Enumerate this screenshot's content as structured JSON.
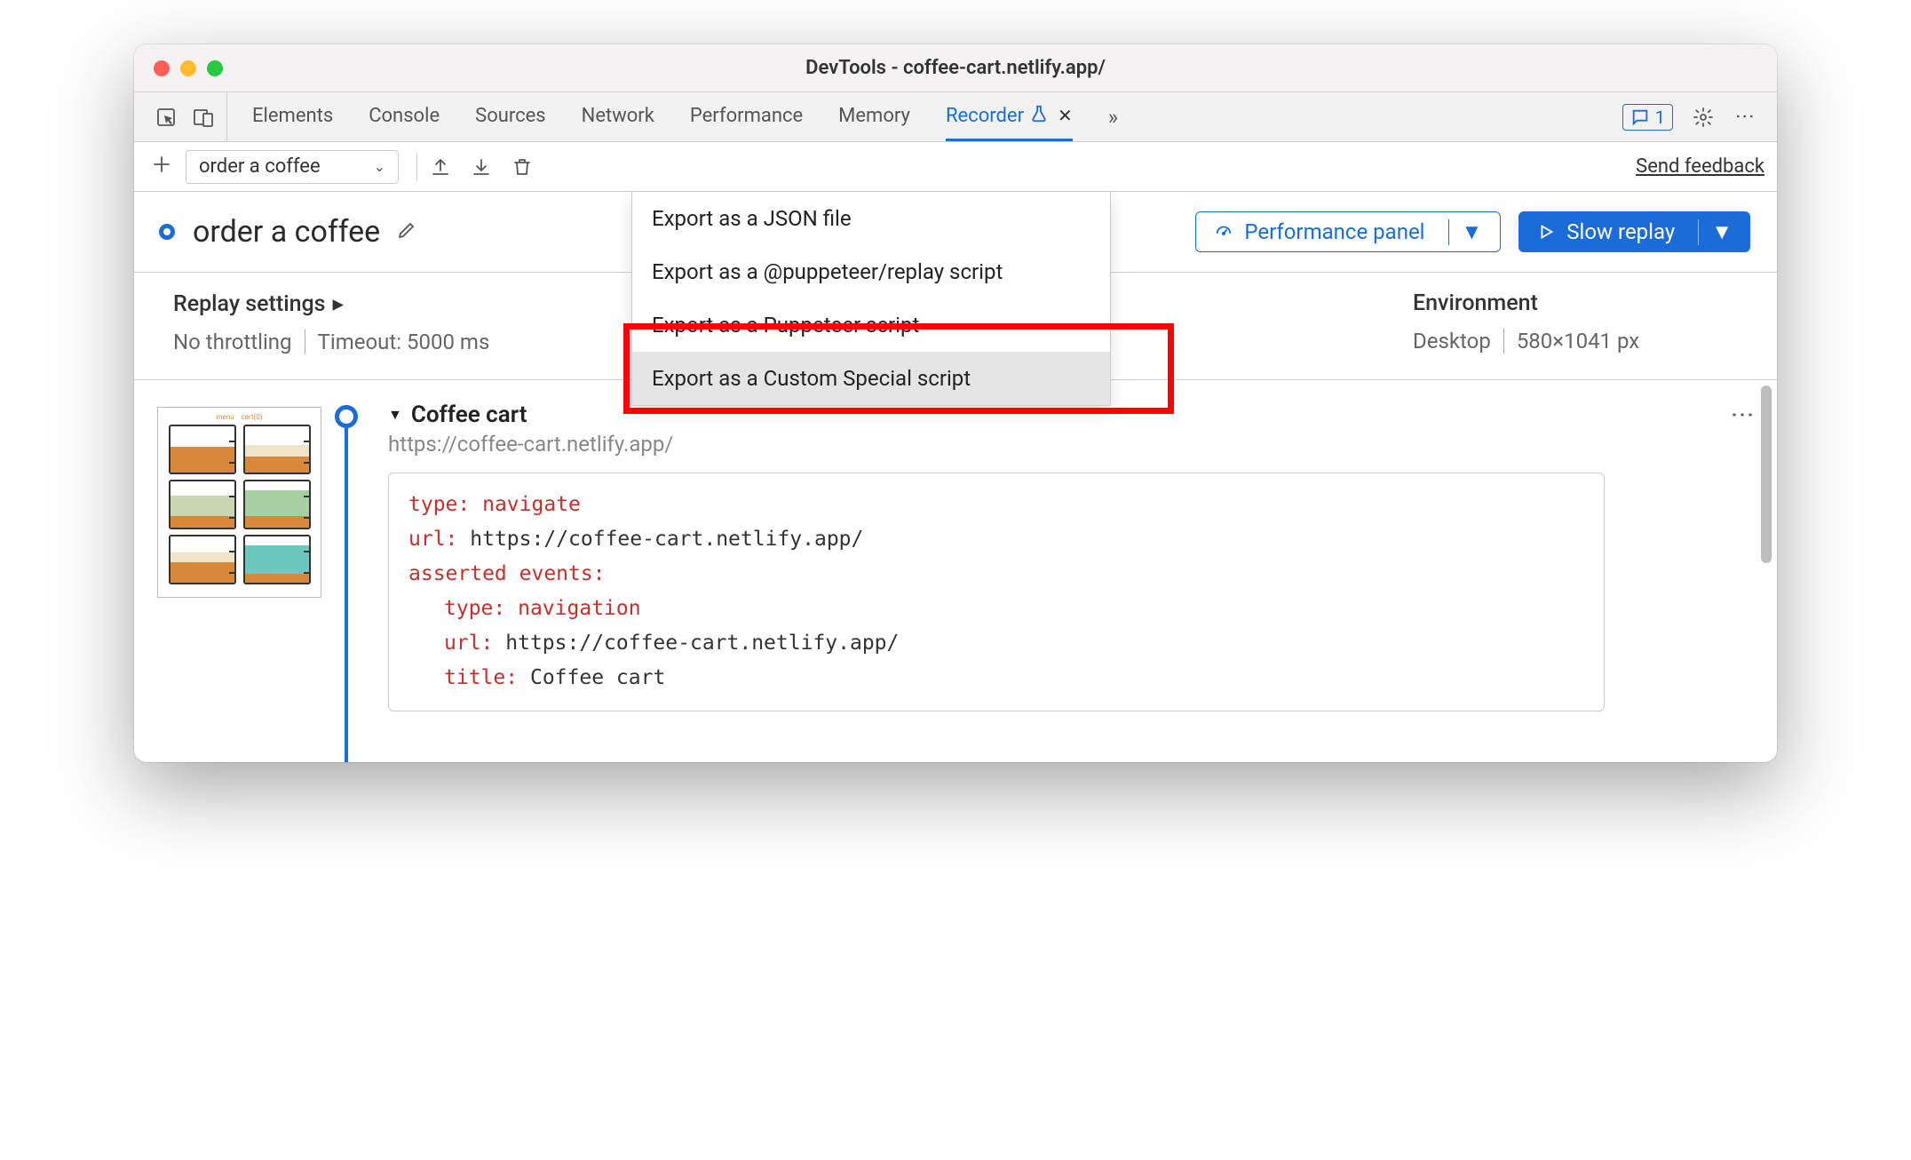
{
  "window": {
    "title": "DevTools - coffee-cart.netlify.app/"
  },
  "tabs": {
    "list": {
      "t0": "Elements",
      "t1": "Console",
      "t2": "Sources",
      "t3": "Network",
      "t4": "Performance",
      "t5": "Memory",
      "t6": "Recorder"
    },
    "issues_count": "1"
  },
  "toolbar": {
    "selected_recording": "order a coffee",
    "feedback": "Send feedback"
  },
  "export_menu": {
    "i0": "Export as a JSON file",
    "i1": "Export as a @puppeteer/replay script",
    "i2": "Export as a Puppeteer script",
    "i3": "Export as a Custom Special script"
  },
  "recording": {
    "title": "order a coffee",
    "perf_btn": "Performance panel",
    "replay_btn": "Slow replay"
  },
  "settings": {
    "heading": "Replay settings",
    "throttling": "No throttling",
    "timeout": "Timeout: 5000 ms",
    "env_heading": "Environment",
    "device": "Desktop",
    "viewport": "580×1041 px"
  },
  "step": {
    "title": "Coffee cart",
    "url": "https://coffee-cart.netlify.app/",
    "raw": {
      "l0k": "type",
      "l0v": "navigate",
      "l1k": "url",
      "l1v": "https://coffee-cart.netlify.app/",
      "l2k": "asserted events",
      "l3k": "type",
      "l3v": "navigation",
      "l4k": "url",
      "l4v": "https://coffee-cart.netlify.app/",
      "l5k": "title",
      "l5v": "Coffee cart"
    }
  }
}
